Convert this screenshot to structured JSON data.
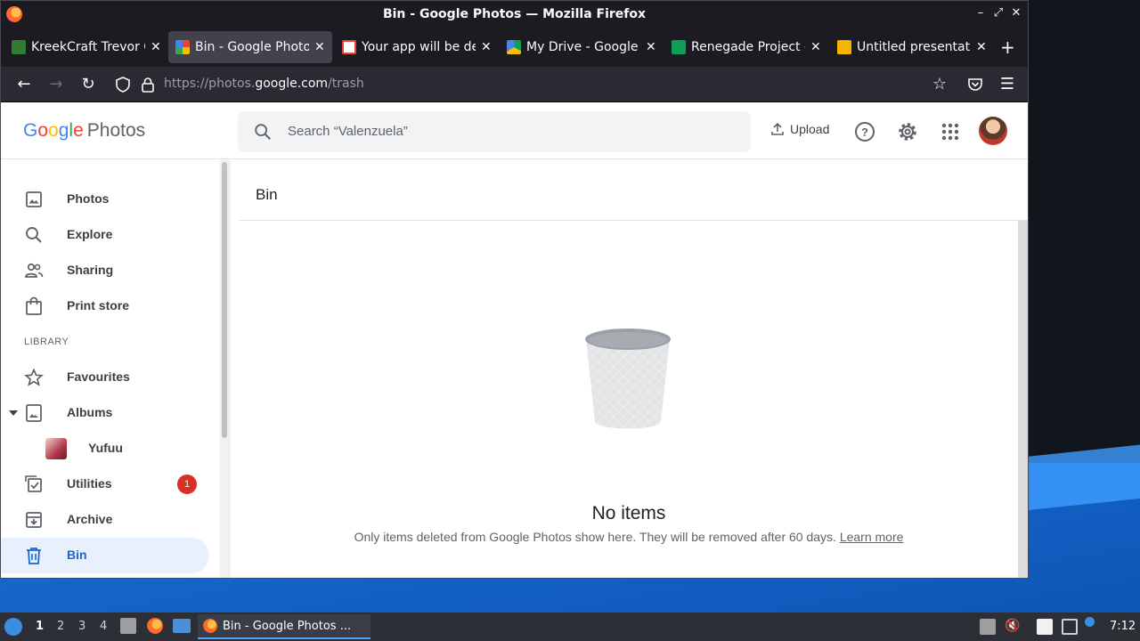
{
  "window": {
    "title": "Bin - Google Photos — Mozilla Firefox",
    "minimize_label": "–",
    "restore_label": "⤢",
    "close_label": "✕"
  },
  "tabs": [
    {
      "label": "KreekCraft Trevor C",
      "favicon_color": "#2f7d32",
      "active": false
    },
    {
      "label": "Bin - Google Photos",
      "favicon_color": "#fbbc04",
      "active": true
    },
    {
      "label": "Your app will be de",
      "favicon_color": "#ea4335",
      "active": false
    },
    {
      "label": "My Drive - Google D",
      "favicon_color": "#1a73e8",
      "active": false
    },
    {
      "label": "Renegade Project -",
      "favicon_color": "#0f9d58",
      "active": false
    },
    {
      "label": "Untitled presentatio",
      "favicon_color": "#f4b400",
      "active": false
    }
  ],
  "newtab_label": "+",
  "url": {
    "prefix": "https://photos.",
    "domain": "google.com",
    "path": "/trash"
  },
  "header": {
    "logo_google": "Google",
    "logo_photos": "Photos",
    "search_placeholder": "Search “Valenzuela”",
    "upload_label": "Upload"
  },
  "sidebar": {
    "items": [
      {
        "label": "Photos",
        "icon": "photo-icon"
      },
      {
        "label": "Explore",
        "icon": "search-icon"
      },
      {
        "label": "Sharing",
        "icon": "people-icon"
      },
      {
        "label": "Print store",
        "icon": "bag-icon"
      }
    ],
    "library_label": "LIBRARY",
    "library_items": [
      {
        "label": "Favourites",
        "icon": "star-icon"
      },
      {
        "label": "Albums",
        "icon": "album-icon"
      },
      {
        "label": "Yufuu",
        "icon": "album-thumb"
      },
      {
        "label": "Utilities",
        "icon": "utilities-icon",
        "badge": "1"
      },
      {
        "label": "Archive",
        "icon": "archive-icon"
      },
      {
        "label": "Bin",
        "icon": "trash-icon",
        "active": true
      }
    ]
  },
  "content": {
    "title": "Bin",
    "empty_title": "No items",
    "empty_desc": "Only items deleted from Google Photos show here. They will be removed after 60 days.",
    "learn_more": "Learn more"
  },
  "taskbar": {
    "workspaces": [
      "1",
      "2",
      "3",
      "4"
    ],
    "active_app": "Bin - Google Photos ...",
    "clock": "7:12"
  },
  "colors": {
    "accent": "#1967d2",
    "active_bg": "#e8f0fe",
    "badge": "#d93025"
  }
}
